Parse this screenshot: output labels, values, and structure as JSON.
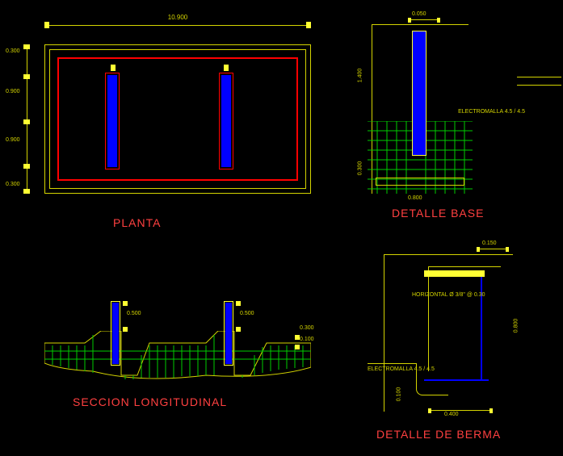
{
  "titles": {
    "planta": "PLANTA",
    "seccion": "SECCION LONGITUDINAL",
    "base": "DETALLE BASE",
    "berma": "DETALLE DE BERMA"
  },
  "dims": {
    "planta_top": "10.900",
    "planta_left_1": "0.300",
    "planta_left_2": "0.900",
    "planta_left_3": "0.900",
    "planta_left_4": "0.300",
    "base_top": "0.050",
    "base_side": "1.400",
    "base_bottom": "0.300",
    "base_foot": "0.800",
    "seccion_h1": "0.500",
    "seccion_h2": "0.100",
    "seccion_h3": "0.300",
    "berma_top": "0.150",
    "berma_side": "0.800",
    "berma_btm": "0.400",
    "berma_left": "0.100"
  },
  "labels": {
    "electromalla": "ELECTROMALLA 4.5 / 4.5",
    "horizontal": "HORIZONTAL Ø 3/8\" @ 0.30",
    "electromalla2": "ELECTROMALLA 4.5 / 4.5"
  }
}
